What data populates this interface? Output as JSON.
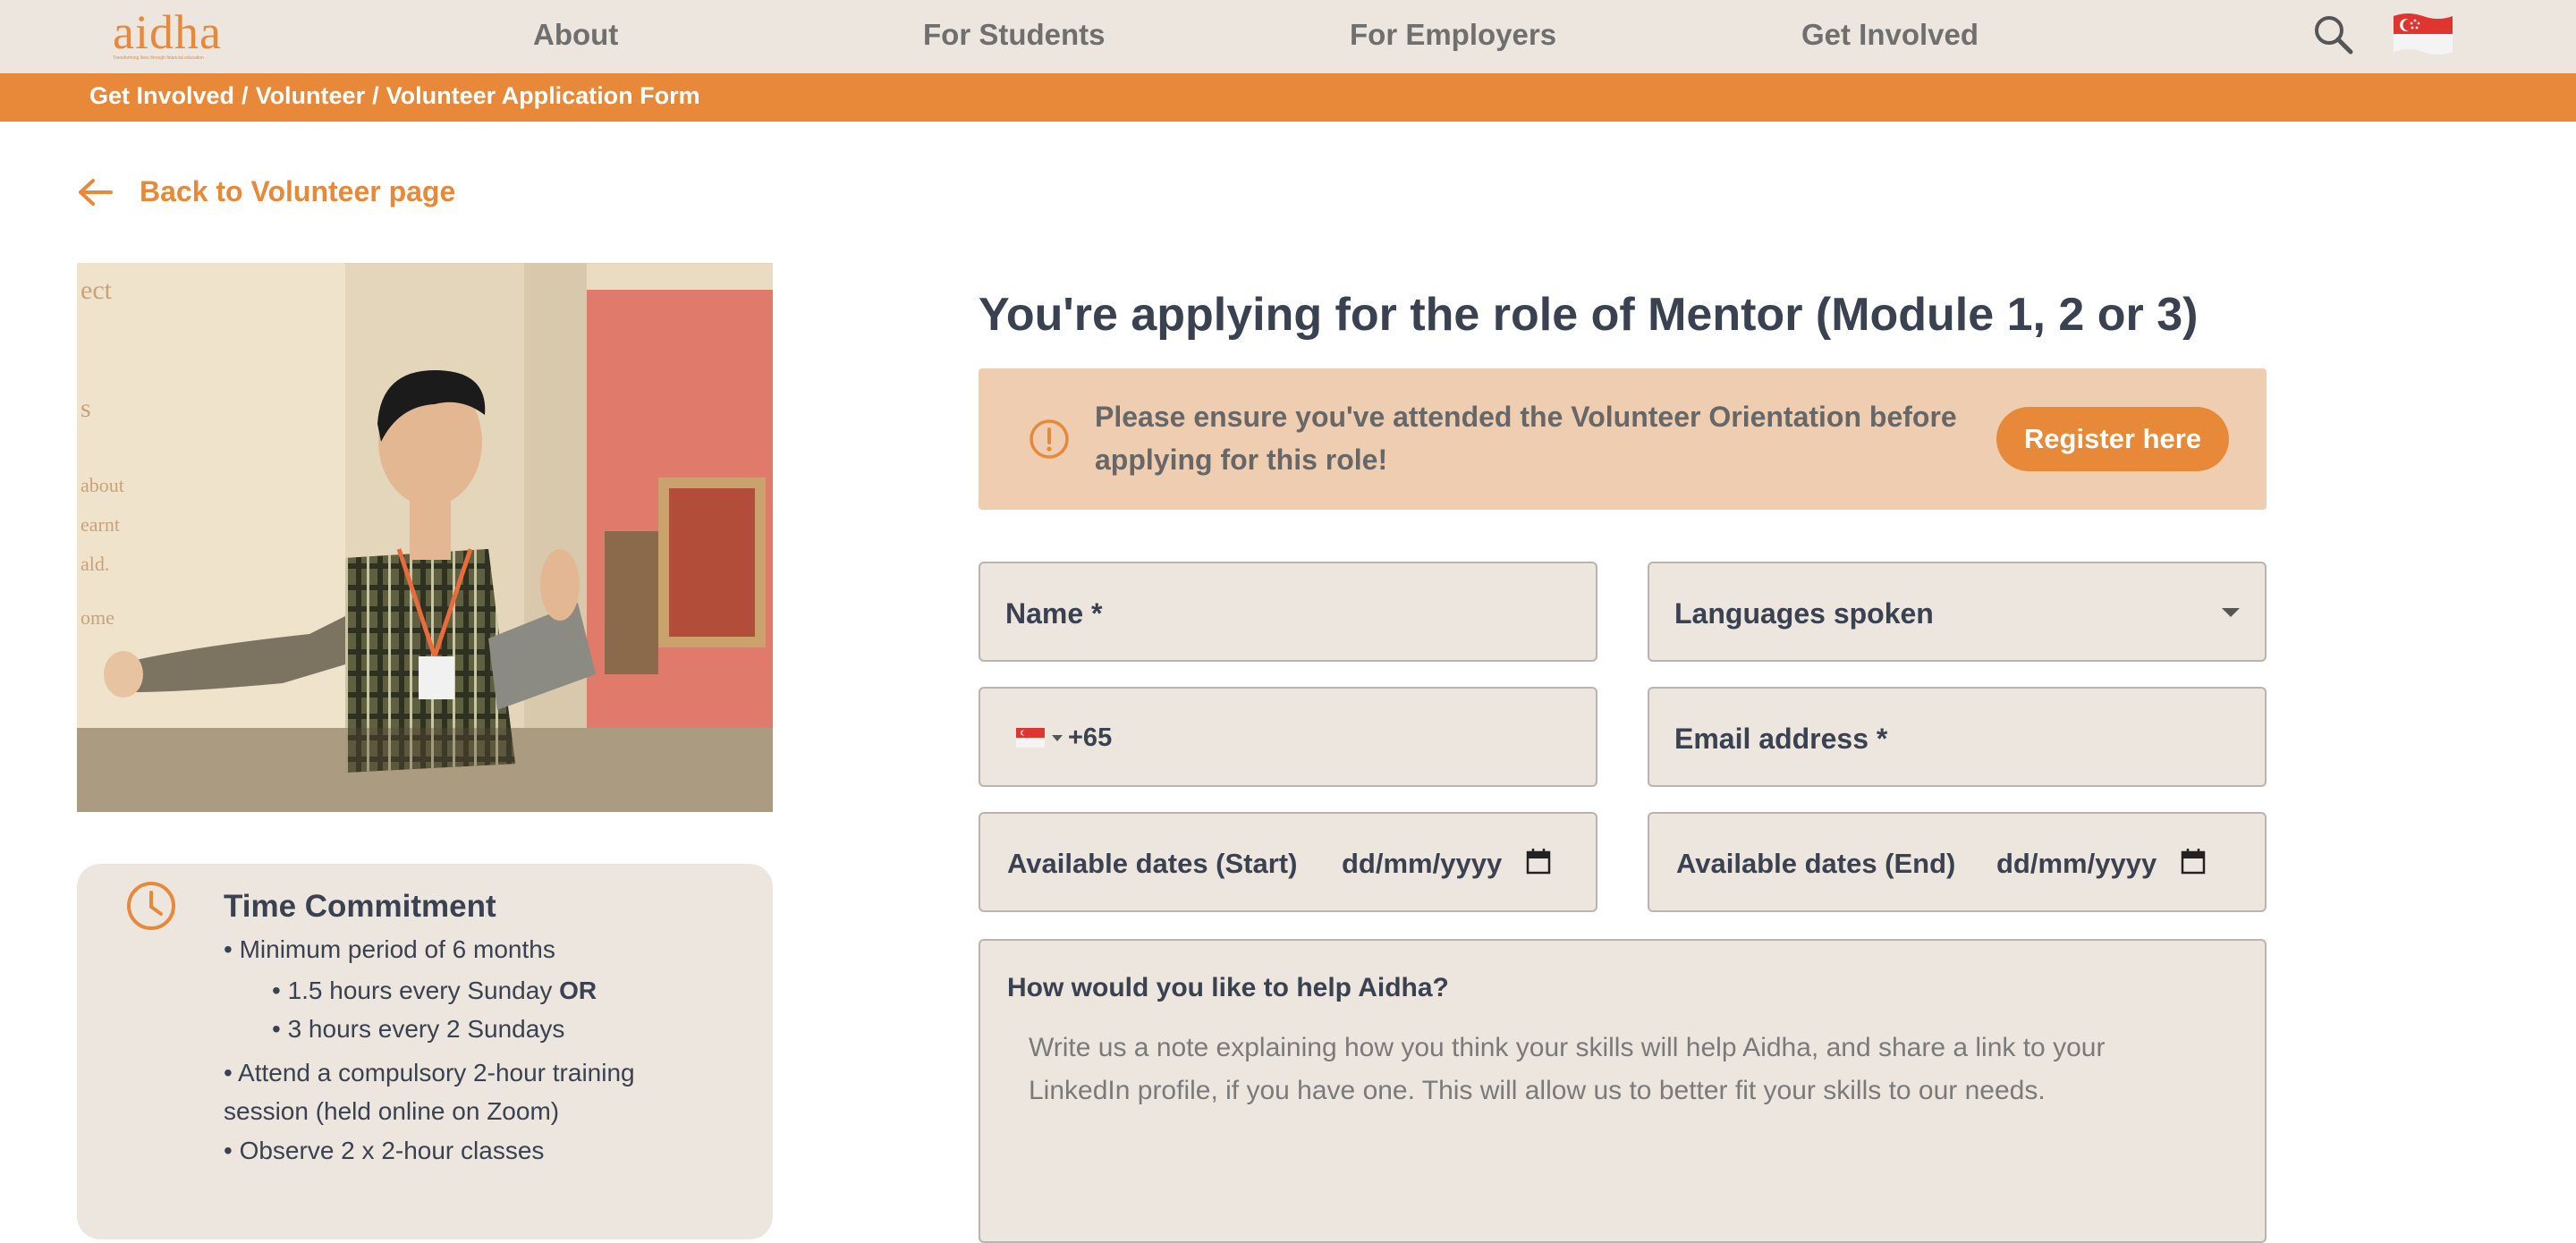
{
  "nav": {
    "logo_text": "aidha",
    "logo_tagline": "Transforming lives through financial education",
    "items": [
      "About",
      "For Students",
      "For Employers",
      "Get Involved"
    ],
    "search_icon": "search-icon",
    "flag_icon": "singapore-flag-icon"
  },
  "breadcrumb": {
    "items": [
      "Get Involved",
      "Volunteer",
      "Volunteer Application Form"
    ],
    "separator": "/"
  },
  "back_link": {
    "label": "Back to Volunteer page",
    "icon": "arrow-left-icon"
  },
  "time_commitment": {
    "title": "Time Commitment",
    "icon": "clock-icon",
    "line1": "• Minimum period of 6 months",
    "line2_text": "• 1.5 hours every Sunday ",
    "line2_bold": "OR",
    "line3": "• 3 hours every 2 Sundays",
    "line4a": "• Attend a compulsory 2-hour training",
    "line4b": "session (held online on Zoom)",
    "line5": "• Observe 2 x 2-hour classes"
  },
  "form": {
    "role_title": "You're applying for the role of Mentor (Module 1, 2 or 3)",
    "notice": {
      "text": "Please ensure you've attended the Volunteer Orientation before applying for this role!",
      "button": "Register here",
      "icon": "exclamation-circle-icon"
    },
    "name_label": "Name *",
    "languages_label": "Languages spoken",
    "phone_code": "+65",
    "email_label": "Email address *",
    "start_label": "Available dates (Start)",
    "end_label": "Available dates (End)",
    "date_placeholder": "dd/mm/yyyy",
    "help_label": "How would you like to help Aidha?",
    "help_placeholder": "Write us a note explaining how you think your skills will help Aidha, and share a link to your LinkedIn profile, if you have one. This will allow us to better fit your skills to our needs."
  },
  "colors": {
    "accent": "#e8893a",
    "nav_bg": "#ede6df",
    "notice_bg": "#eecdb0",
    "field_bg": "#ede6df"
  }
}
